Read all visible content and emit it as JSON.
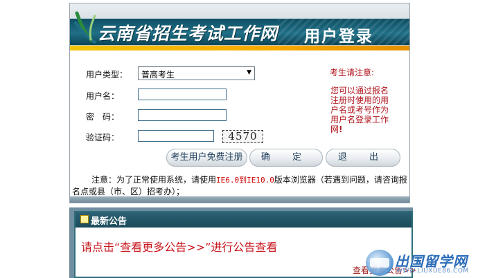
{
  "header": {
    "site_title": "云南省招生考试工作网",
    "login_title": "用户登录"
  },
  "form": {
    "usertype_label": "用户类型：",
    "usertype_value": "普高考生",
    "username_label": "用户名：",
    "password_label": "密　码：",
    "captcha_label": "验证码：",
    "captcha_text": "4570"
  },
  "buttons": {
    "register": "考生用户免费注册",
    "confirm": "确 定",
    "exit": "退 出"
  },
  "notice": {
    "prefix": "注意：为了正常使用系统，请使用",
    "browser_range": "IE6.0到IE10.0",
    "suffix": "版本浏览器（若遇到问题，请咨询报名点或县（市、区）招考办）；"
  },
  "side_note": {
    "title": "考生请注意:",
    "body": "您可以通过报名注册时使用的用户名或考号作为用户名登录工作网",
    "mark": "!"
  },
  "announcement": {
    "title": "最新公告",
    "message": "请点击“查看更多公告>>”进行公告查看",
    "more_link": "查看更多公告>>"
  },
  "watermark": {
    "name": "出国留学网",
    "url": "WWW.LIUXUE86.COM"
  },
  "colors": {
    "header_band": "#1f6f86",
    "accent_stripe": "#f7a900",
    "notice_red": "#b0171f",
    "announce_header": "#1a4a5a"
  }
}
